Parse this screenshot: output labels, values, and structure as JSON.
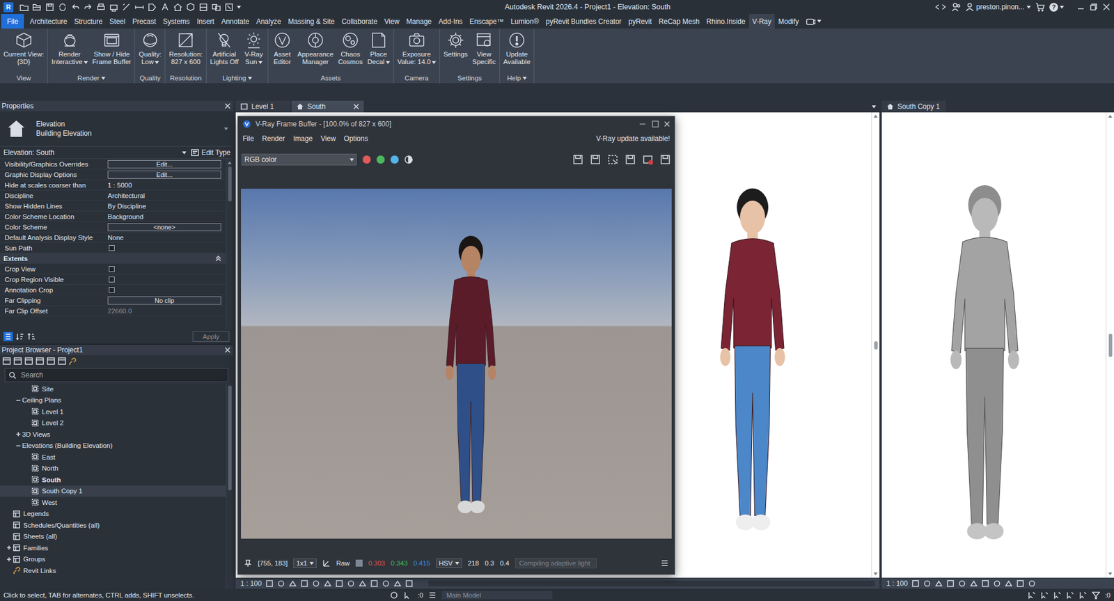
{
  "window": {
    "app": "R",
    "title": "Autodesk Revit 2026.4 - Project1 - Elevation: South",
    "user": "preston.pinon...",
    "help": "?"
  },
  "ribbon_tabs": [
    {
      "label": "File",
      "selected": false,
      "kind": "file"
    },
    {
      "label": "Architecture",
      "selected": false,
      "kind": "tab"
    },
    {
      "label": "Structure",
      "selected": false,
      "kind": "tab"
    },
    {
      "label": "Steel",
      "selected": false,
      "kind": "tab"
    },
    {
      "label": "Precast",
      "selected": false,
      "kind": "tab"
    },
    {
      "label": "Systems",
      "selected": false,
      "kind": "tab"
    },
    {
      "label": "Insert",
      "selected": false,
      "kind": "tab"
    },
    {
      "label": "Annotate",
      "selected": false,
      "kind": "tab"
    },
    {
      "label": "Analyze",
      "selected": false,
      "kind": "tab"
    },
    {
      "label": "Massing & Site",
      "selected": false,
      "kind": "tab"
    },
    {
      "label": "Collaborate",
      "selected": false,
      "kind": "tab"
    },
    {
      "label": "View",
      "selected": false,
      "kind": "tab"
    },
    {
      "label": "Manage",
      "selected": false,
      "kind": "tab"
    },
    {
      "label": "Add-Ins",
      "selected": false,
      "kind": "tab"
    },
    {
      "label": "Enscape™",
      "selected": false,
      "kind": "tab"
    },
    {
      "label": "Lumion®",
      "selected": false,
      "kind": "tab"
    },
    {
      "label": "pyRevit Bundles Creator",
      "selected": false,
      "kind": "tab"
    },
    {
      "label": "pyRevit",
      "selected": false,
      "kind": "tab"
    },
    {
      "label": "ReCap Mesh",
      "selected": false,
      "kind": "tab"
    },
    {
      "label": "Rhino.Inside",
      "selected": false,
      "kind": "tab"
    },
    {
      "label": "V-Ray",
      "selected": true,
      "kind": "tab"
    },
    {
      "label": "Modify",
      "selected": false,
      "kind": "tab"
    }
  ],
  "ribbon_panels": [
    {
      "title": "View",
      "caret": false,
      "buttons": [
        {
          "lines": [
            "Current View:",
            "{3D}"
          ],
          "caret": false
        }
      ]
    },
    {
      "title": "Render",
      "caret": true,
      "buttons": [
        {
          "lines": [
            "Render",
            "Interactive"
          ],
          "caret": true
        },
        {
          "lines": [
            "Show / Hide",
            "Frame Buffer"
          ],
          "caret": false
        }
      ]
    },
    {
      "title": "Quality",
      "caret": false,
      "buttons": [
        {
          "lines": [
            "Quality:",
            "Low"
          ],
          "caret": true
        }
      ]
    },
    {
      "title": "Resolution",
      "caret": false,
      "buttons": [
        {
          "lines": [
            "Resolution:",
            "827 x 600"
          ],
          "caret": false
        }
      ]
    },
    {
      "title": "Lighting",
      "caret": true,
      "buttons": [
        {
          "lines": [
            "Artificial",
            "Lights Off"
          ],
          "caret": false
        },
        {
          "lines": [
            "V-Ray",
            "Sun"
          ],
          "caret": true
        }
      ]
    },
    {
      "title": "Assets",
      "caret": false,
      "buttons": [
        {
          "lines": [
            "Asset",
            "Editor"
          ],
          "caret": false
        },
        {
          "lines": [
            "Appearance",
            "Manager"
          ],
          "caret": false
        },
        {
          "lines": [
            "Chaos",
            "Cosmos"
          ],
          "caret": false
        },
        {
          "lines": [
            "Place",
            "Decal"
          ],
          "caret": true
        }
      ]
    },
    {
      "title": "Camera",
      "caret": false,
      "buttons": [
        {
          "lines": [
            "Exposure",
            "Value: 14.0"
          ],
          "caret": true
        }
      ]
    },
    {
      "title": "Settings",
      "caret": false,
      "buttons": [
        {
          "lines": [
            "Settings"
          ],
          "caret": false
        },
        {
          "lines": [
            "View",
            "Specific"
          ],
          "caret": false
        }
      ]
    },
    {
      "title": "Help",
      "caret": true,
      "buttons": [
        {
          "lines": [
            "Update",
            "Available"
          ],
          "caret": false
        }
      ]
    }
  ],
  "properties": {
    "title": "Properties",
    "type_name": "Elevation",
    "type_sub": "Building Elevation",
    "selector": "Elevation: South",
    "edit_type": "Edit Type",
    "rows": [
      {
        "kind": "button",
        "label": "Visibility/Graphics Overrides",
        "value": "Edit..."
      },
      {
        "kind": "button",
        "label": "Graphic Display Options",
        "value": "Edit..."
      },
      {
        "kind": "text",
        "label": "Hide at scales coarser than",
        "value": "1 : 5000",
        "disabled": false
      },
      {
        "kind": "text",
        "label": "Discipline",
        "value": "Architectural",
        "disabled": false
      },
      {
        "kind": "text",
        "label": "Show Hidden Lines",
        "value": "By Discipline",
        "disabled": false
      },
      {
        "kind": "text",
        "label": "Color Scheme Location",
        "value": "Background",
        "disabled": false
      },
      {
        "kind": "button",
        "label": "Color Scheme",
        "value": "<none>"
      },
      {
        "kind": "text",
        "label": "Default Analysis Display Style",
        "value": "None",
        "disabled": false
      },
      {
        "kind": "checkbox",
        "label": "Sun Path",
        "checked": false
      },
      {
        "kind": "header",
        "label": "Extents",
        "expanded": true
      },
      {
        "kind": "checkbox",
        "label": "Crop View",
        "checked": false
      },
      {
        "kind": "checkbox",
        "label": "Crop Region Visible",
        "checked": false
      },
      {
        "kind": "checkbox",
        "label": "Annotation Crop",
        "checked": false
      },
      {
        "kind": "button",
        "label": "Far Clipping",
        "value": "No clip"
      },
      {
        "kind": "text",
        "label": "Far Clip Offset",
        "value": "22660.0",
        "disabled": true
      }
    ],
    "apply": "Apply",
    "apply_disabled": true
  },
  "project_browser": {
    "title": "Project Browser - Project1",
    "search_placeholder": "Search",
    "items": [
      {
        "label": "Site",
        "level": 2,
        "kind": "view",
        "expandable": false,
        "expanded": false,
        "selected": false,
        "hovered": false
      },
      {
        "label": "Ceiling Plans",
        "level": 1,
        "kind": "group",
        "expandable": true,
        "expanded": true,
        "selected": false,
        "hovered": false
      },
      {
        "label": "Level 1",
        "level": 2,
        "kind": "view",
        "expandable": false,
        "expanded": false,
        "selected": false,
        "hovered": false
      },
      {
        "label": "Level 2",
        "level": 2,
        "kind": "view",
        "expandable": false,
        "expanded": false,
        "selected": false,
        "hovered": false
      },
      {
        "label": "3D Views",
        "level": 1,
        "kind": "group",
        "expandable": true,
        "expanded": false,
        "selected": false,
        "hovered": false
      },
      {
        "label": "Elevations (Building Elevation)",
        "level": 1,
        "kind": "group",
        "expandable": true,
        "expanded": true,
        "selected": false,
        "hovered": false
      },
      {
        "label": "East",
        "level": 2,
        "kind": "view",
        "expandable": false,
        "expanded": false,
        "selected": false,
        "hovered": false
      },
      {
        "label": "North",
        "level": 2,
        "kind": "view",
        "expandable": false,
        "expanded": false,
        "selected": false,
        "hovered": false
      },
      {
        "label": "South",
        "level": 2,
        "kind": "view",
        "expandable": false,
        "expanded": false,
        "selected": true,
        "hovered": false
      },
      {
        "label": "South Copy 1",
        "level": 2,
        "kind": "view",
        "expandable": false,
        "expanded": false,
        "selected": false,
        "hovered": true
      },
      {
        "label": "West",
        "level": 2,
        "kind": "view",
        "expandable": false,
        "expanded": false,
        "selected": false,
        "hovered": false
      },
      {
        "label": "Legends",
        "level": 0,
        "kind": "category",
        "expandable": false,
        "expanded": false,
        "selected": false,
        "hovered": false
      },
      {
        "label": "Schedules/Quantities (all)",
        "level": 0,
        "kind": "category",
        "expandable": false,
        "expanded": false,
        "selected": false,
        "hovered": false
      },
      {
        "label": "Sheets (all)",
        "level": 0,
        "kind": "category",
        "expandable": false,
        "expanded": false,
        "selected": false,
        "hovered": false
      },
      {
        "label": "Families",
        "level": 0,
        "kind": "category",
        "expandable": true,
        "expanded": false,
        "selected": false,
        "hovered": false
      },
      {
        "label": "Groups",
        "level": 0,
        "kind": "category",
        "expandable": true,
        "expanded": false,
        "selected": false,
        "hovered": false
      },
      {
        "label": "Revit Links",
        "level": 0,
        "kind": "link",
        "expandable": false,
        "expanded": false,
        "selected": false,
        "hovered": false
      }
    ]
  },
  "view_tabs": [
    {
      "label": "Level 1",
      "selected": false,
      "closable": false
    },
    {
      "label": "South",
      "selected": true,
      "closable": true
    }
  ],
  "side_view": {
    "tab": "South Copy 1",
    "scale": "1 : 100"
  },
  "main_view": {
    "scale": "1 : 100"
  },
  "frame_buffer": {
    "title": "V-Ray Frame Buffer - [100.0% of 827 x 600]",
    "menu": [
      "File",
      "Render",
      "Image",
      "View",
      "Options"
    ],
    "notice": "V-Ray update available!",
    "channel": "RGB color",
    "channels": [
      {
        "color": "#e05a5a"
      },
      {
        "color": "#4cb85c"
      },
      {
        "color": "#56b4e9"
      }
    ],
    "coords": "[755, 183]",
    "zoom": "1x1",
    "raw": "Raw",
    "readout": [
      {
        "value": "0.303",
        "color": "#e0504f"
      },
      {
        "value": "0.343",
        "color": "#3fbf55"
      },
      {
        "value": "0.415",
        "color": "#3d8fe0"
      }
    ],
    "mode": "HSV",
    "hsv": [
      "218",
      "0.3",
      "0.4"
    ],
    "progress": "Compiling adaptive light"
  },
  "status_bar": {
    "hint": "Click to select, TAB for alternates, CTRL adds, SHIFT unselects.",
    "count": ":0",
    "model": "Main Model",
    "filter": ":0"
  }
}
